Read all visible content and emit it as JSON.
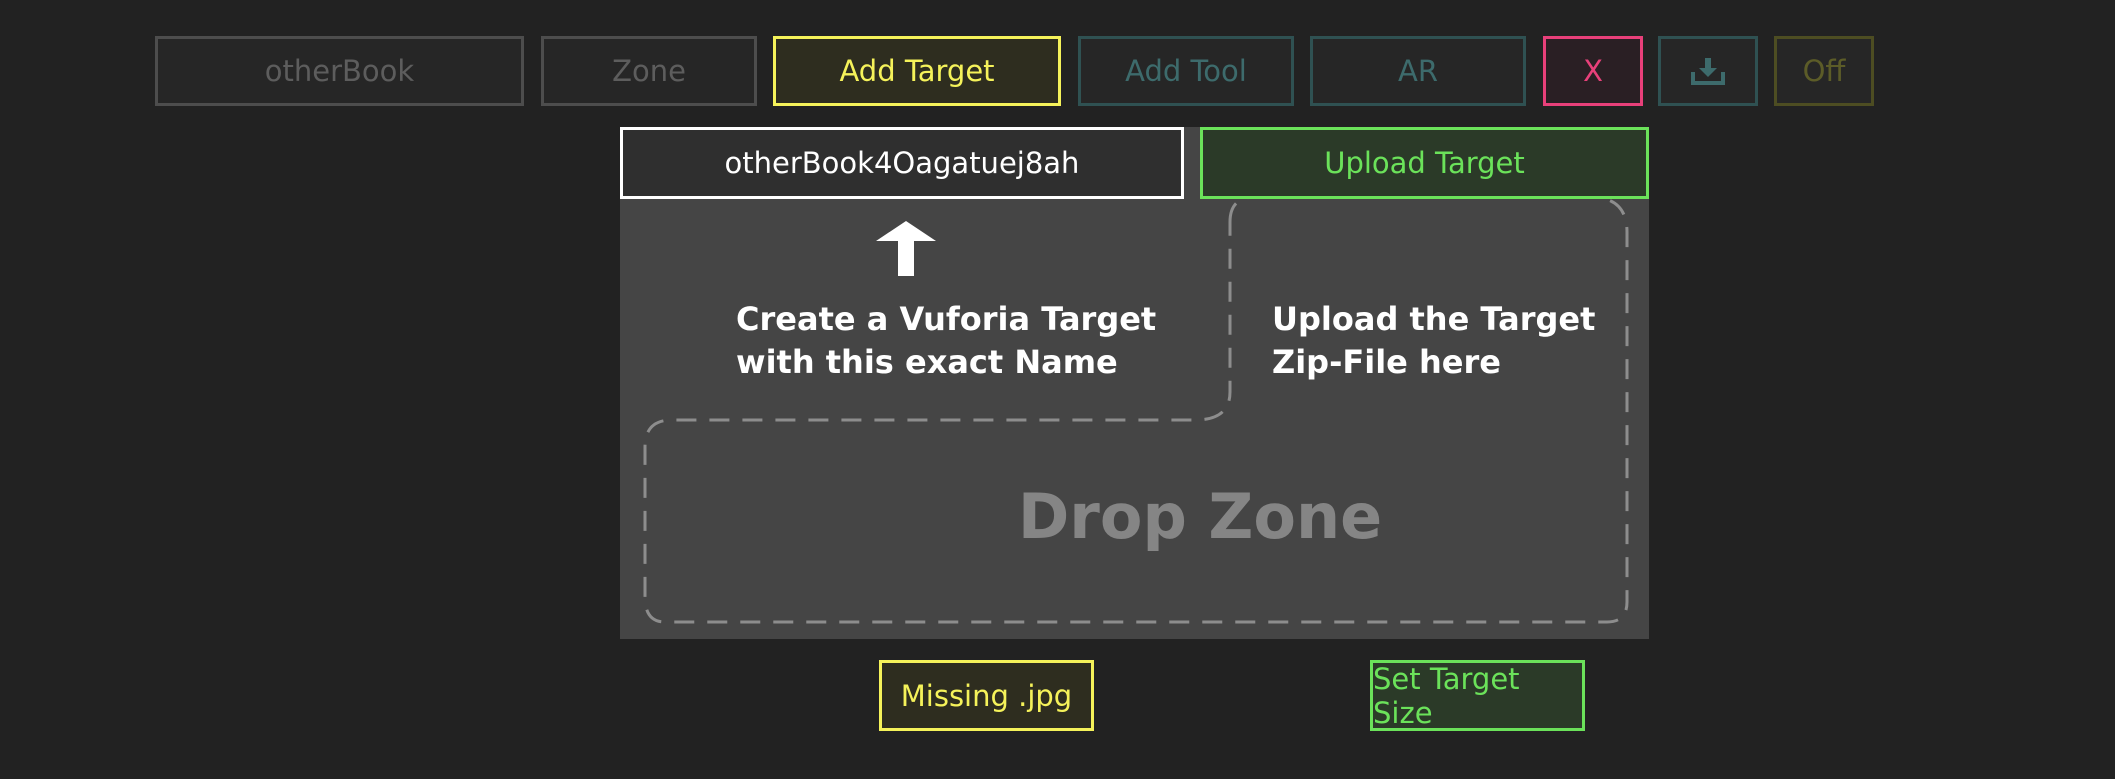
{
  "toolbar": {
    "otherbook_label": "otherBook",
    "zone_label": "Zone",
    "add_target_label": "Add Target",
    "add_tool_label": "Add Tool",
    "ar_label": "AR",
    "close_label": "X",
    "download_icon": "download-tray-icon",
    "off_label": "Off"
  },
  "target": {
    "name_value": "otherBook4Oagatuej8ah",
    "upload_label": "Upload Target",
    "create_instruction": "Create a Vuforia Target\nwith this exact Name",
    "upload_instruction": "Upload the Target\nZip-File here",
    "drop_zone_label": "Drop Zone",
    "arrow_icon": "arrow-up-icon"
  },
  "footer": {
    "missing_label": "Missing .jpg",
    "set_size_label": "Set Target Size"
  },
  "colors": {
    "background": "#222222",
    "panel": "#454545",
    "yellow_accent": "#f5f25a",
    "green_accent": "#6be25a",
    "red_accent": "#e8407a",
    "teal_inactive": "#2f5152"
  }
}
